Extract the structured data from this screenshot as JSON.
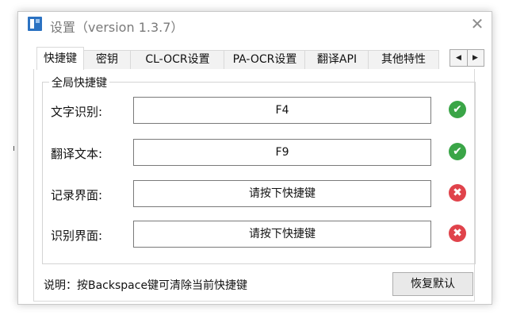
{
  "window": {
    "title": "设置（version 1.3.7）",
    "close": "✕"
  },
  "tabs": [
    {
      "label": "快捷键",
      "active": true
    },
    {
      "label": "密钥",
      "active": false
    },
    {
      "label": "CL-OCR设置",
      "active": false
    },
    {
      "label": "PA-OCR设置",
      "active": false
    },
    {
      "label": "翻译API",
      "active": false
    },
    {
      "label": "其他特性",
      "active": false
    }
  ],
  "tab_scroll": {
    "left": "◀",
    "right": "▶"
  },
  "shortcuts": {
    "group_title": "全局快捷键",
    "rows": [
      {
        "label": "文字识别:",
        "value": "F4",
        "status": "ok",
        "status_glyph": "✔"
      },
      {
        "label": "翻译文本:",
        "value": "F9",
        "status": "ok",
        "status_glyph": "✔"
      },
      {
        "label": "记录界面:",
        "value": "请按下快捷键",
        "status": "error",
        "status_glyph": "✖"
      },
      {
        "label": "识别界面:",
        "value": "请按下快捷键",
        "status": "error",
        "status_glyph": "✖"
      }
    ]
  },
  "footer": {
    "note": "说明：按Backspace键可清除当前快捷键",
    "reset_label": "恢复默认"
  },
  "colors": {
    "ok": "#3aa547",
    "error": "#e0434b",
    "app_icon": "#2b72c2"
  }
}
